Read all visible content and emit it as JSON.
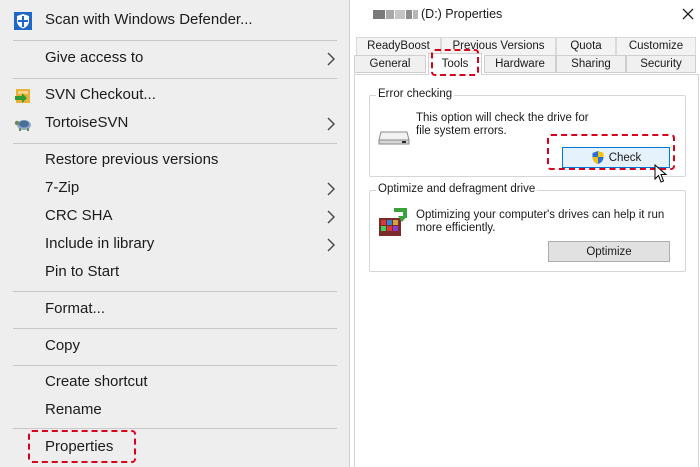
{
  "context_menu": {
    "items": [
      {
        "label": "Scan with Windows Defender...",
        "icon": "defender-shield-icon"
      },
      {
        "label": "Give access to",
        "submenu": true
      },
      {
        "label": "SVN Checkout...",
        "icon": "svn-checkout-icon"
      },
      {
        "label": "TortoiseSVN",
        "icon": "tortoisesvn-icon",
        "submenu": true
      },
      {
        "label": "Restore previous versions"
      },
      {
        "label": "7-Zip",
        "submenu": true
      },
      {
        "label": "CRC SHA",
        "submenu": true
      },
      {
        "label": "Include in library",
        "submenu": true
      },
      {
        "label": "Pin to Start"
      },
      {
        "label": "Format..."
      },
      {
        "label": "Copy"
      },
      {
        "label": "Create shortcut"
      },
      {
        "label": "Rename"
      },
      {
        "label": "Properties",
        "highlighted": true
      }
    ]
  },
  "dialog": {
    "title": "(D:) Properties",
    "tabs_back": [
      "ReadyBoost",
      "Previous Versions",
      "Quota",
      "Customize"
    ],
    "tabs_front": [
      "General",
      "Tools",
      "Hardware",
      "Sharing",
      "Security"
    ],
    "active_tab": "Tools",
    "error_checking": {
      "title": "Error checking",
      "description": "This option will check the drive for file system errors.",
      "button": "Check"
    },
    "optimize": {
      "title": "Optimize and defragment drive",
      "description": "Optimizing your computer's drives can help it run more efficiently.",
      "button": "Optimize"
    }
  },
  "colors": {
    "highlight": "#d9001b",
    "menu_background": "#eeeeee",
    "focus_blue": "#0078d7"
  }
}
